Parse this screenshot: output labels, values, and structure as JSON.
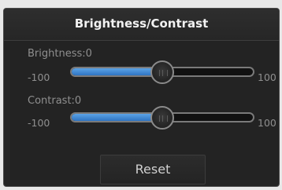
{
  "dialog": {
    "title": "Brightness/Contrast"
  },
  "brightness": {
    "label": "Brightness:0",
    "min_label": "-100",
    "max_label": "100",
    "min": -100,
    "max": 100,
    "value": 0
  },
  "contrast": {
    "label": "Contrast:0",
    "min_label": "-100",
    "max_label": "100",
    "min": -100,
    "max": 100,
    "value": 0
  },
  "buttons": {
    "reset_label": "Reset"
  },
  "colors": {
    "panel_bg": "#232323",
    "slider_fill": "#3b86d6",
    "text_muted": "#8f8f8f"
  }
}
